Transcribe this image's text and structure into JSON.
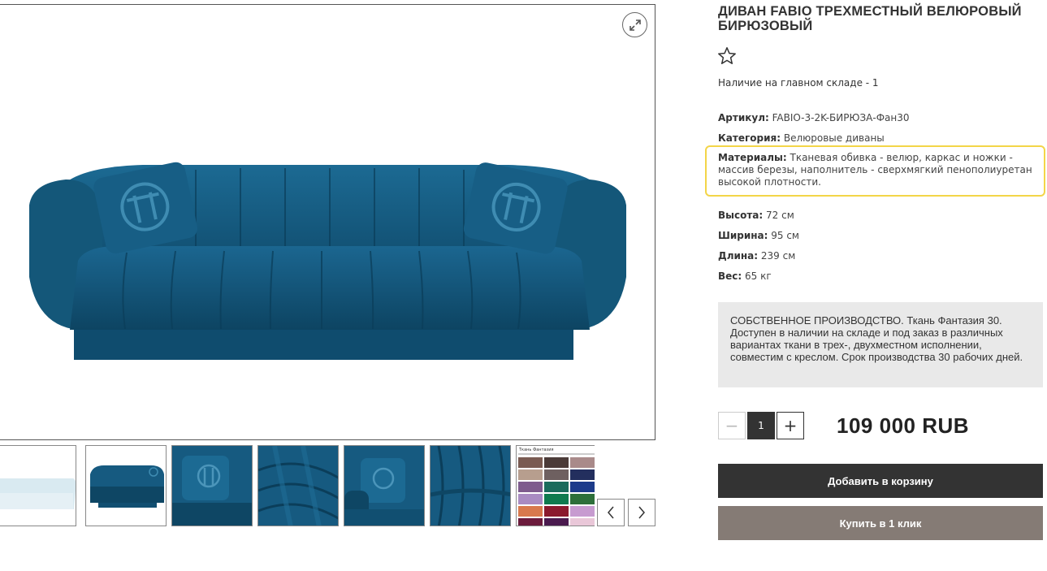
{
  "product": {
    "title": "ДИВАН FABIO ТРЕХМЕСТНЫЙ ВЕЛЮРОВЫЙ БИРЮЗОВЫЙ",
    "stock": "Наличие на главном складе - 1",
    "article_label": "Артикул:",
    "article_value": "FABIO-3-2K-БИРЮЗА-Фан30",
    "category_label": "Категория:",
    "category_value": "Велюровые диваны",
    "materials_label": "Материалы:",
    "materials_value": "Тканевая обивка - велюр, каркас и ножки - массив березы, наполнитель - сверхмягкий пенополиуретан высокой плотности.",
    "height_label": "Высота:",
    "height_value": "72 см",
    "width_label": "Ширина:",
    "width_value": "95 см",
    "length_label": "Длина:",
    "length_value": "239 см",
    "weight_label": "Вес:",
    "weight_value": "65 кг",
    "note": "СОБСТВЕННОЕ ПРОИЗВОДСТВО. Ткань Фантазия 30. Доступен в наличии на складе и под заказ в различных вариантах ткани в трех-, двухместном исполнении, совместим с креслом. Срок производства 30 рабочих дней."
  },
  "purchase": {
    "qty_minus": "−",
    "qty_value": "1",
    "qty_plus": "+",
    "price": "109 000 RUB",
    "add_to_cart": "Добавить в корзину",
    "buy_one_click": "Купить в 1 клик"
  },
  "gallery": {
    "thumbnail_count": 7,
    "swatch_sheet_header": "Ткань Фантазия",
    "colors": {
      "sofa": "#165a80",
      "sofa_dark": "#0e4664",
      "sofa_light": "#1f6d96",
      "accent_border": "#f3d548"
    },
    "icons": [
      "expand-icon",
      "star-icon",
      "arrow-left-icon",
      "arrow-right-icon"
    ]
  }
}
